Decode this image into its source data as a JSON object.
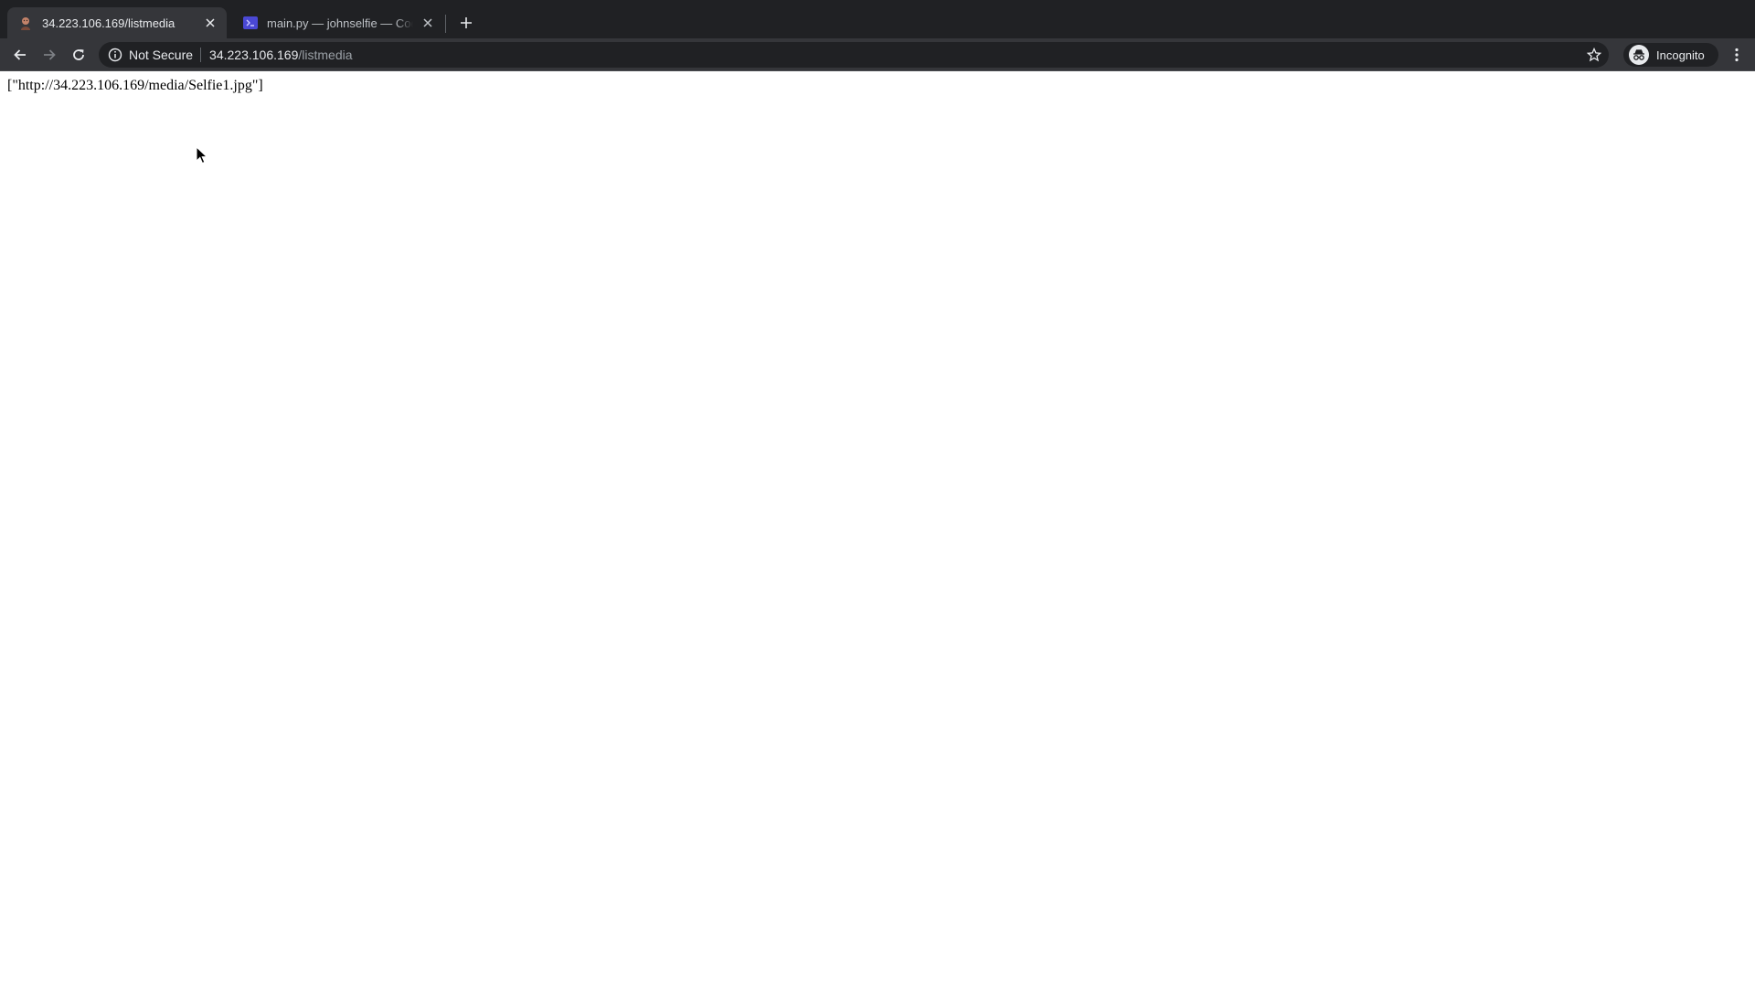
{
  "browser": {
    "tabs": [
      {
        "title": "34.223.106.169/listmedia",
        "active": true,
        "favicon": "selfie-favicon-icon"
      },
      {
        "title": "main.py — johnselfie — Code - OSS",
        "active": false,
        "favicon": "vscode-icon"
      }
    ],
    "new_tab_icon": "plus-icon",
    "toolbar": {
      "back_icon": "arrow-left-icon",
      "forward_icon": "arrow-right-icon",
      "reload_icon": "reload-icon",
      "security_icon": "info-icon",
      "security_label": "Not Secure",
      "url_host": "34.223.106.169",
      "url_path": "/listmedia",
      "bookmark_icon": "star-icon",
      "profile_label": "Incognito",
      "menu_icon": "kebab-menu-icon"
    }
  },
  "page": {
    "body_text": "[\"http://34.223.106.169/media/Selfie1.jpg\"]"
  },
  "colors": {
    "tabstrip_bg": "#202124",
    "toolbar_bg": "#35363a",
    "omnibox_bg": "#202124",
    "page_bg": "#ffffff"
  }
}
